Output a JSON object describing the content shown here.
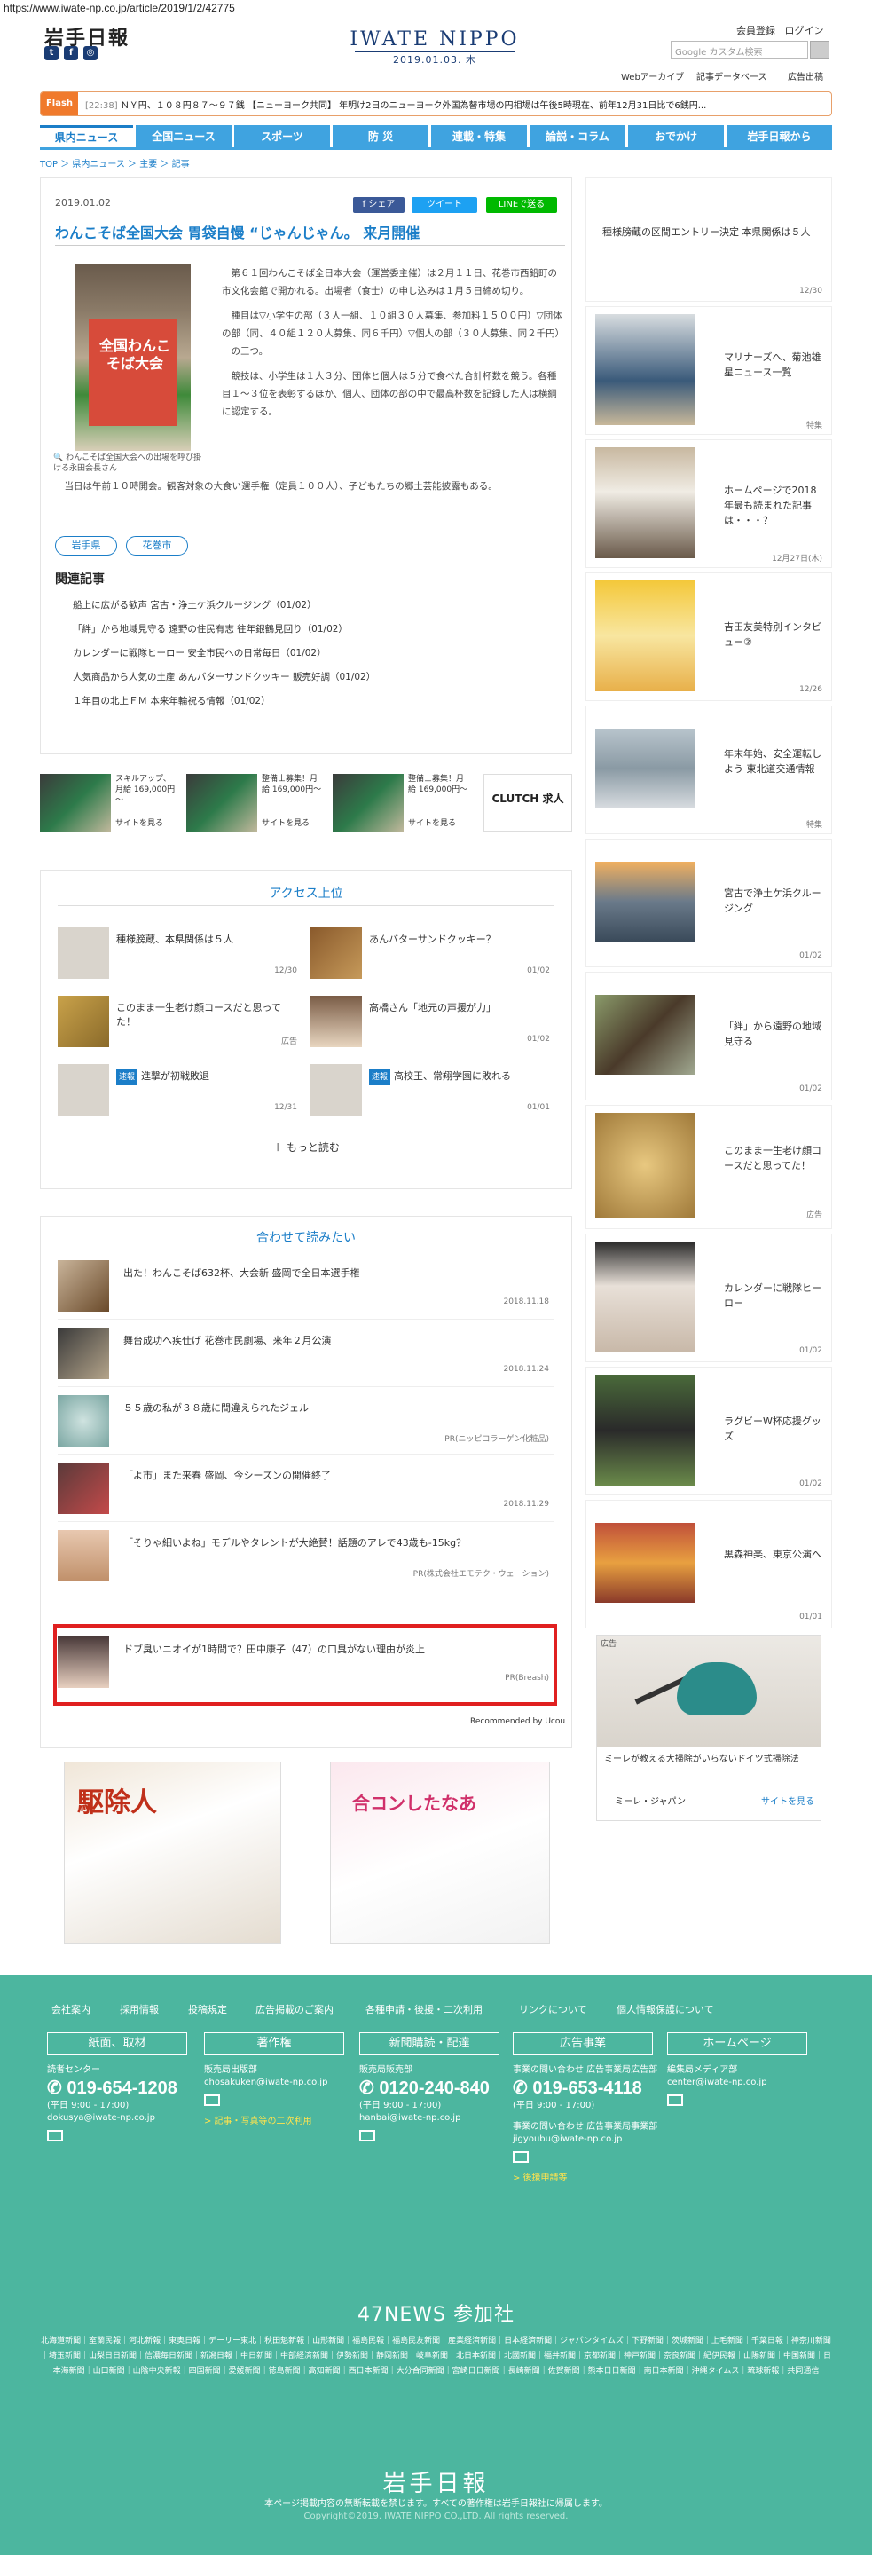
{
  "browser": {
    "url": "https://www.iwate-np.co.jp/article/2019/1/2/42775"
  },
  "header": {
    "logo": "岩手日報",
    "brand": "IWATE NIPPO",
    "date": "2019.01.03. 木",
    "member_register": "会員登録",
    "login": "ログイン",
    "search_placeholder": "Google カスタム検索",
    "subnav": [
      "Webアーカイブ",
      "記事データベース",
      "広告出稿"
    ]
  },
  "flash": {
    "label": "Flash",
    "time": "[22:38]",
    "text": "ＮＹ円、１０８円８７～９７銭 【ニューヨーク共同】 年明け2日のニューヨーク外国為替市場の円相場は午後5時現在、前年12月31日比で6銭円..."
  },
  "nav": {
    "tabs": [
      "県内ニュース",
      "全国ニュース",
      "スポーツ",
      "防 災",
      "連載・特集",
      "論説・コラム",
      "おでかけ",
      "岩手日報から"
    ],
    "active_index": 0
  },
  "breadcrumb": "TOP ＞ 県内ニュース ＞ 主要 ＞ 記事",
  "article": {
    "date": "2019.01.02",
    "title": "わんこそば全国大会 胃袋自慢 “じゃんじゃん。 来月開催",
    "share_labels": [
      "f シェア",
      "ツイート",
      "LINEで送る"
    ],
    "photo_sign": "全国わんこそば大会",
    "photo_caption": "わんこそば全国大会への出場を呼び掛ける永田会長さん",
    "body": [
      "第６１回わんこそば全日本大会（運営委主催）は２月１１日、花巻市西鉛町の市文化会館で開かれる。出場者（食士）の申し込みは１月５日締め切り。",
      "種目は▽小学生の部（３人一組、１０組３０人募集、参加料１５００円）▽団体の部（同、４０組１２０人募集、同６千円）▽個人の部（３０人募集、同２千円）－の三つ。",
      "競技は、小学生は１人３分、団体と個人は５分で食べた合計杯数を競う。各種目１～３位を表彰するほか、個人、団体の部の中で最高杯数を記録した人は横綱に認定する。"
    ],
    "body_tail": "当日は午前１０時開会。観客対象の大食い選手権（定員１００人）、子どもたちの郷土芸能披露もある。",
    "tags": [
      "岩手県",
      "花巻市"
    ],
    "related_title": "関連記事",
    "related": [
      "船上に広がる歓声 宮古・浄土ケ浜クルージング（01/02）",
      "「絆」から地域見守る 遠野の住民有志 往年銀鶴見回り（01/02）",
      "カレンダーに戦隊ヒーロー 安全市民への日常毎日（01/02）",
      "人気商品から人気の土産 あんバターサンドクッキー 販売好調（01/02）",
      "１年目の北上ＦＭ 本来年輪祝る情報（01/02）"
    ]
  },
  "ad_strip": [
    {
      "text": "スキルアップ、月給 169,000円～",
      "btn": "サイトを見る"
    },
    {
      "text": "整備士募集！月給 169,000円～",
      "btn": "サイトを見る"
    },
    {
      "text": "整備士募集！月給 169,000円～",
      "btn": "サイトを見る"
    },
    {
      "text": "CLUTCH 求人",
      "btn": ""
    }
  ],
  "access": {
    "title": "アクセス上位",
    "items": [
      {
        "text": "種様膀蔵、本県関係は５人",
        "date": "12/30",
        "badge": ""
      },
      {
        "text": "あんバターサンドクッキー？",
        "date": "01/02",
        "badge": ""
      },
      {
        "text": "このまま一生老け顔コースだと思ってた！",
        "date": "広告",
        "badge": ""
      },
      {
        "text": "高橋さん「地元の声援が力」",
        "date": "01/02",
        "badge": ""
      },
      {
        "text": "進撃が初戦敗退",
        "date": "12/31",
        "badge": "速報"
      },
      {
        "text": "高校王、常翔学園に敗れる",
        "date": "01/01",
        "badge": "速報"
      }
    ],
    "more": "＋ もっと読む"
  },
  "recommend": {
    "title": "合わせて読みたい",
    "items": [
      {
        "text": "出た！わんこそば632杯、大会新 盛岡で全日本選手権",
        "date": "2018.11.18"
      },
      {
        "text": "舞台成功へ疾仕げ 花巻市民劇場、来年２月公演",
        "date": "2018.11.24"
      },
      {
        "text": "５５歳の私が３８歳に間違えられたジェル",
        "date": "PR(ニッピコラーゲン化粧品)"
      },
      {
        "text": "「よ市」また来春 盛岡、今シーズンの開催終了",
        "date": "2018.11.29"
      },
      {
        "text": "「そりゃ細いよね」モデルやタレントが大絶賛！話題のアレで43歳も-15kg？",
        "date": "PR(株式会社エモテク・ウェーション)"
      },
      {
        "text": "ドブ臭いニオイが1時間で？田中康子（47）の口臭がない理由が炎上",
        "date": "PR(Breash)"
      }
    ],
    "credit": "Recommended by Ucou"
  },
  "manga": [
    {
      "text": "駆除人"
    },
    {
      "text": "合コンしたなあ"
    }
  ],
  "sidebar": [
    {
      "text": "種様膀蔵の区間エントリー決定 本県関係は５人",
      "date": "12/30"
    },
    {
      "text": "マリナーズへ、菊池雄星ニュース一覧",
      "date": "特集"
    },
    {
      "text": "ホームページで2018年最も読まれた記事は・・・？",
      "date": "12月27日(木)"
    },
    {
      "text": "吉田友美特別インタビュー②",
      "date": "12/26"
    },
    {
      "text": "年末年始、安全運転しよう 東北道交通情報",
      "date": "特集"
    },
    {
      "text": "宮古で浄土ケ浜クルージング",
      "date": "01/02"
    },
    {
      "text": "「絆」から遠野の地域見守る",
      "date": "01/02"
    },
    {
      "text": "このまま一生老け顔コースだと思ってた！",
      "date": "広告"
    },
    {
      "text": "カレンダーに戦隊ヒーロー",
      "date": "01/02"
    },
    {
      "text": "ラグビーW杯応援グッズ",
      "date": "01/02"
    },
    {
      "text": "黒森神楽、東京公演へ",
      "date": "01/01"
    }
  ],
  "side_ad": {
    "label": "広告",
    "text": "ミーレが教える大掃除がいらないドイツ式掃除法",
    "brand": "ミーレ・ジャパン",
    "btn": "サイトを見る"
  },
  "footer": {
    "links": [
      "会社案内",
      "採用情報",
      "投稿規定",
      "広告掲載のご案内",
      "各種申請・後援・二次利用",
      "リンクについて",
      "個人情報保護について"
    ],
    "boxes": [
      "紙面、取材",
      "著作権",
      "新聞購読・配達",
      "広告事業",
      "ホームページ"
    ],
    "col1": {
      "title": "読者センター",
      "phone": "019-654-1208",
      "hours": "(平日 9:00 - 17:00)",
      "mail": "dokusya@iwate-np.co.jp"
    },
    "col2": {
      "title": "販売局出版部",
      "mail": "chosakuken@iwate-np.co.jp",
      "note": "> 記事・写真等の二次利用"
    },
    "col3": {
      "title": "販売局販売部",
      "phone": "0120-240-840",
      "hours": "(平日 9:00 - 17:00)",
      "mail": "hanbai@iwate-np.co.jp"
    },
    "col4": {
      "title": "事業の問い合わせ 広告事業局広告部",
      "phone": "019-653-4118",
      "hours": "(平日 9:00 - 17:00)",
      "title2": "事業の問い合わせ 広告事業局事業部",
      "mail": "jigyoubu@iwate-np.co.jp",
      "note": "> 後援申請等"
    },
    "col5": {
      "title": "編集局メディア部",
      "mail": "center@iwate-np.co.jp"
    },
    "news47_title": "47NEWS 参加社",
    "news47_list": "北海道新聞｜室蘭民報｜河北新報｜東奥日報｜デーリー東北｜秋田魁新報｜山形新聞｜福島民報｜福島民友新聞｜産業経済新聞｜日本経済新聞｜ジャパンタイムズ｜下野新聞｜茨城新聞｜上毛新聞｜千葉日報｜神奈川新聞｜埼玉新聞｜山梨日日新聞｜信濃毎日新聞｜新潟日報｜中日新聞｜中部経済新聞｜伊勢新聞｜静岡新聞｜岐阜新聞｜北日本新聞｜北國新聞｜福井新聞｜京都新聞｜神戸新聞｜奈良新聞｜紀伊民報｜山陽新聞｜中国新聞｜日本海新聞｜山口新聞｜山陰中央新報｜四国新聞｜愛媛新聞｜徳島新聞｜高知新聞｜西日本新聞｜大分合同新聞｜宮崎日日新聞｜長崎新聞｜佐賀新聞｜熊本日日新聞｜南日本新聞｜沖縄タイムス｜琉球新報｜共同通信",
    "logo": "岩手日報",
    "note": "本ページ掲載内容の無断転載を禁じます。すべての著作権は岩手日報社に帰属します。",
    "copyright": "Copyright©2019. IWATE NIPPO CO.,LTD. All rights reserved."
  }
}
